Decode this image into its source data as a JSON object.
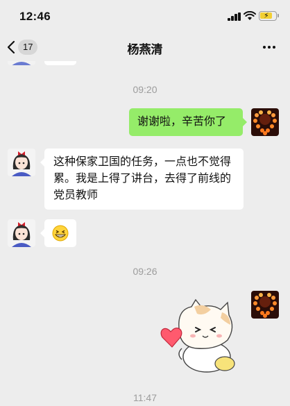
{
  "status_bar": {
    "time": "12:46",
    "icons": [
      "signal-icon",
      "wifi-icon",
      "battery-charging-icon"
    ],
    "battery_color": "#f2cf33"
  },
  "nav": {
    "back_icon": "chevron-left-icon",
    "unread_count": "17",
    "title": "杨燕清",
    "more_icon": "more-dots-icon"
  },
  "colors": {
    "background": "#ededed",
    "incoming_bubble": "#ffffff",
    "outgoing_bubble": "#95ec69",
    "timestamp_text": "#9c9c9c"
  },
  "chat": {
    "timestamps": [
      "09:20",
      "09:26",
      "11:47"
    ],
    "messages": [
      {
        "from": "self",
        "type": "text",
        "text": "谢谢啦，辛苦你了"
      },
      {
        "from": "contact",
        "type": "text",
        "text": "这种保家卫国的任务，一点也不觉得累。我是上得了讲台，去得了前线的党员教师"
      },
      {
        "from": "contact",
        "type": "emoji",
        "emoji": "grin-emoji-icon"
      },
      {
        "from": "self",
        "type": "sticker",
        "sticker": "cat-holding-heart-sticker"
      }
    ]
  }
}
